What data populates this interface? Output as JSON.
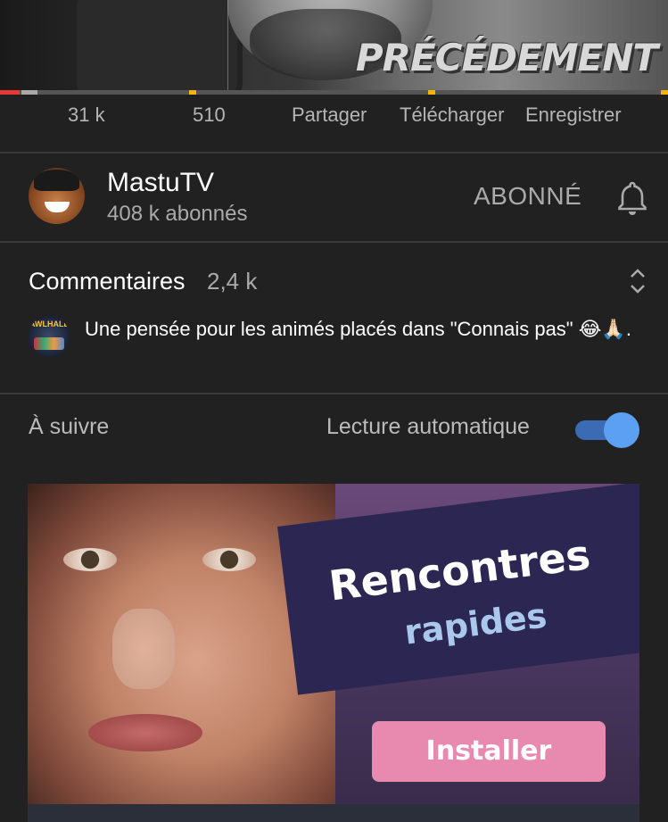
{
  "video": {
    "overlay_text": "PRÉCÉDEMENT",
    "progress_played_fraction": 0.03,
    "colors": {
      "played": "#e53935",
      "ad_marker": "#f4b400"
    }
  },
  "actions": [
    {
      "label": "31 k",
      "icon": "like-icon"
    },
    {
      "label": "510",
      "icon": "dislike-icon"
    },
    {
      "label": "Partager",
      "icon": "share-icon"
    },
    {
      "label": "Télécharger",
      "icon": "download-icon"
    },
    {
      "label": "Enregistrer",
      "icon": "save-icon"
    }
  ],
  "channel": {
    "name": "MastuTV",
    "subscribers": "408 k abonnés",
    "subscribe_state": "ABONNÉ"
  },
  "comments": {
    "title": "Commentaires",
    "count": "2,4 k",
    "top_comment": {
      "avatar_text": "AWLHALL",
      "text": "Une pensée pour les animés placés dans \"Connais pas\" 😂🙏🏻."
    }
  },
  "upnext": {
    "label": "À suivre",
    "autoplay_label": "Lecture automatique",
    "autoplay_on": true,
    "toggle_color": "#5ba0f2"
  },
  "ad": {
    "headline": "Rencontres",
    "subheadline": "rapides",
    "button_label": "Installer",
    "button_color": "#e88ab0"
  }
}
